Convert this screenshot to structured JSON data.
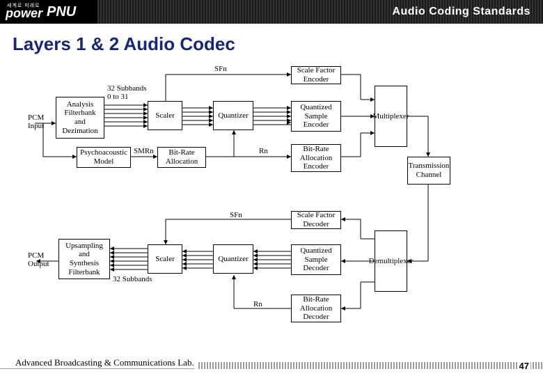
{
  "header": {
    "logo_kr": "세계로 미래로",
    "logo_power": "power",
    "logo_pnu": "PNU",
    "title": "Audio Coding Standards"
  },
  "slide_title": "Layers 1 & 2 Audio Codec",
  "encoder": {
    "pcm_input": "PCM\nInput",
    "analysis": "Analysis\nFilterbank\nand\nDezimation",
    "subbands_label": "32 Subbands\n0 to 31",
    "scaler": "Scaler",
    "sfn": "SFn",
    "quantizer": "Quantizer",
    "sf_encoder": "Scale Factor\nEncoder",
    "qs_encoder": "Quantized\nSample\nEncoder",
    "psycho": "Psychoacoustic\nModel",
    "smrn": "SMRn",
    "bra": "Bit-Rate\nAllocation",
    "rn": "Rn",
    "bra_encoder": "Bit-Rate\nAllocation\nEncoder",
    "mux": "Multiplexer",
    "channel": "Transmission\nChannel"
  },
  "decoder": {
    "pcm_output": "PCM\nOutput",
    "synth": "Upsampling\nand\nSynthesis\nFilterbank",
    "subbands_label": "32 Subbands",
    "scaler": "Scaler",
    "sfn": "SFn",
    "quantizer": "Quantizer",
    "sf_decoder": "Scale Factor\nDecoder",
    "qs_decoder": "Quantized\nSample\nDecoder",
    "rn": "Rn",
    "bra_decoder": "Bit-Rate\nAllocation\nDecoder",
    "demux": "Demultiplexer"
  },
  "footer": {
    "lab": "Advanced Broadcasting & Communications Lab.",
    "page": "47"
  }
}
